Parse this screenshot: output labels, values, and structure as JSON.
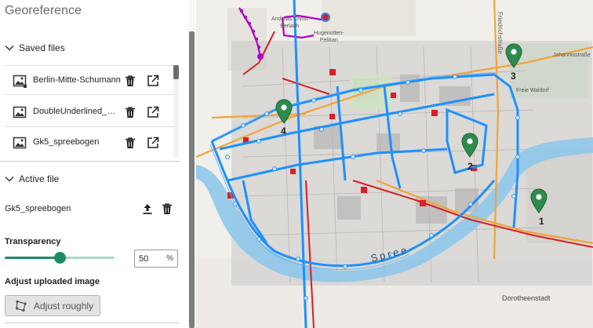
{
  "panel": {
    "title": "Georeference",
    "saved_files": {
      "header": "Saved files",
      "files": [
        {
          "name": "Berlin-Mitte-Schumann"
        },
        {
          "name": "DoubleUnderlined_Berlin"
        },
        {
          "name": "Gk5_spreebogen"
        }
      ]
    },
    "active_file": {
      "header": "Active file",
      "name": "Gk5_spreebogen"
    },
    "transparency": {
      "label": "Transparency",
      "value": "50",
      "unit": "%",
      "slider_percent": 50
    },
    "adjust": {
      "label": "Adjust uploaded image",
      "button": "Adjust roughly"
    }
  },
  "map": {
    "labels": {
      "andreas_line1": "Andreas Christ",
      "andreas_line2": "Berlach",
      "pelikan_line1": "Hugenotten-",
      "pelikan_line2": "Pelikan",
      "johannes": "Johannisstraße",
      "waldorf": "Freie Waldorf",
      "dorotheenstadt": "Dorotheenstadt",
      "spree": "Spree",
      "friedrich": "Friedrichstraße"
    },
    "control_points": [
      "1",
      "2",
      "3",
      "4"
    ]
  },
  "colors": {
    "accent_green": "#1f8a64",
    "marker_green": "#2e8b4e",
    "route_blue": "#1e90ff",
    "river_blue": "#8fc6ea",
    "road_orange": "#f2a33a",
    "transit_red": "#d91e26",
    "line_purple": "#b000c8"
  },
  "icons": [
    "chevron-down-icon",
    "image-icon",
    "trash-icon",
    "open-external-icon",
    "upload-icon",
    "adjust-icon",
    "map-marker-icon"
  ]
}
